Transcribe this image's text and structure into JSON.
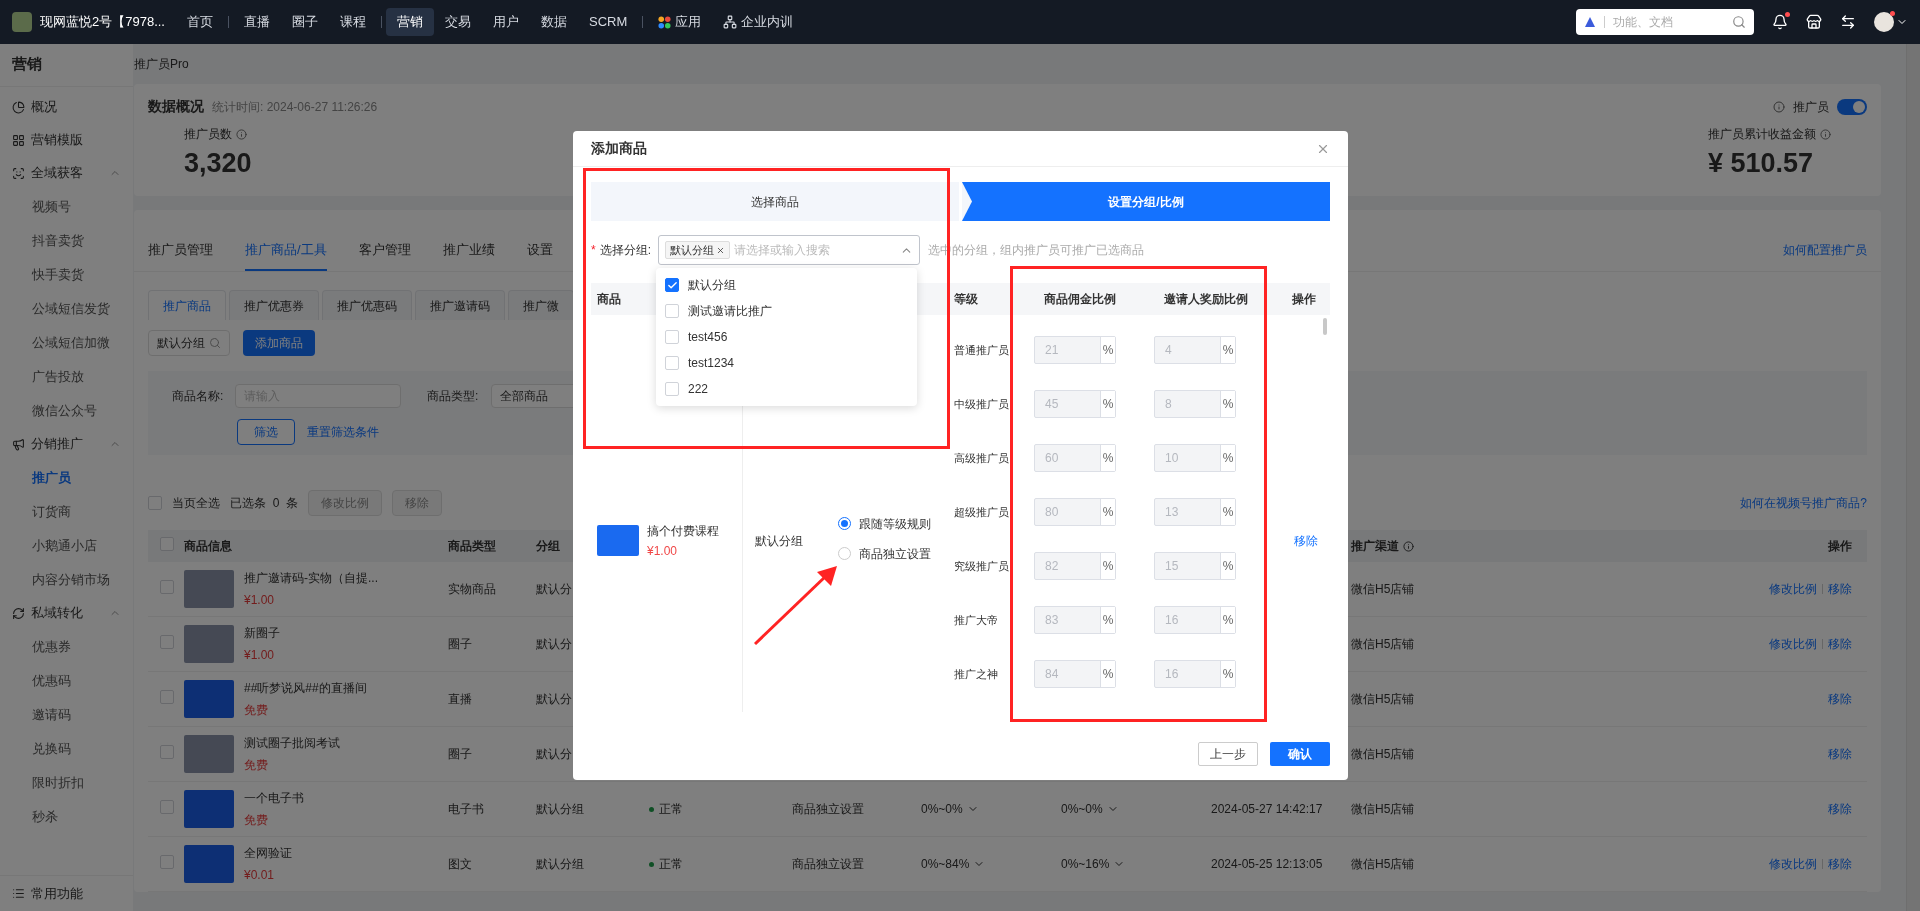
{
  "topbar": {
    "shop_name": "现网蓝悦2号【7978...",
    "nav_groups": [
      {
        "items": [
          {
            "label": "首页",
            "selected": false,
            "kind": "text"
          }
        ]
      },
      {
        "items": [
          {
            "label": "直播",
            "selected": false,
            "kind": "text"
          },
          {
            "label": "圈子",
            "selected": false,
            "kind": "text"
          },
          {
            "label": "课程",
            "selected": false,
            "kind": "text"
          }
        ]
      },
      {
        "items": [
          {
            "label": "营销",
            "selected": true,
            "kind": "text"
          },
          {
            "label": "交易",
            "selected": false,
            "kind": "text"
          },
          {
            "label": "用户",
            "selected": false,
            "kind": "text"
          },
          {
            "label": "数据",
            "selected": false,
            "kind": "text"
          },
          {
            "label": "SCRM",
            "selected": false,
            "kind": "text"
          }
        ]
      },
      {
        "items": [
          {
            "label": "应用",
            "selected": false,
            "kind": "apps"
          },
          {
            "label": "企业内训",
            "selected": false,
            "kind": "training"
          }
        ]
      }
    ],
    "search": {
      "placeholder": "功能、文档"
    }
  },
  "sidebar": {
    "title": "营销",
    "items": [
      {
        "label": "概况",
        "selected": false
      },
      {
        "label": "营销模版",
        "selected": false
      },
      {
        "label": "全域获客",
        "selected": false,
        "expanded": true,
        "children": [
          {
            "label": "视频号",
            "selected": false
          },
          {
            "label": "抖音卖货",
            "selected": false
          },
          {
            "label": "快手卖货",
            "selected": false
          },
          {
            "label": "公域短信发货",
            "selected": false
          },
          {
            "label": "公域短信加微",
            "selected": false
          },
          {
            "label": "广告投放",
            "selected": false
          },
          {
            "label": "微信公众号",
            "selected": false
          }
        ]
      },
      {
        "label": "分销推广",
        "selected": false,
        "expanded": true,
        "children": [
          {
            "label": "推广员",
            "selected": true
          },
          {
            "label": "订货商",
            "selected": false
          },
          {
            "label": "小鹅通小店",
            "selected": false
          },
          {
            "label": "内容分销市场",
            "selected": false
          }
        ]
      },
      {
        "label": "私域转化",
        "selected": false,
        "expanded": true,
        "children": [
          {
            "label": "优惠券",
            "selected": false
          },
          {
            "label": "优惠码",
            "selected": false
          },
          {
            "label": "邀请码",
            "selected": false
          },
          {
            "label": "兑换码",
            "selected": false
          },
          {
            "label": "限时折扣",
            "selected": false
          },
          {
            "label": "秒杀",
            "selected": false
          }
        ]
      }
    ],
    "footer": "常用功能"
  },
  "breadcrumb": "推广员Pro",
  "overview": {
    "title": "数据概况",
    "stat_time": "统计时间: 2024-06-27 11:26:26",
    "toggle": {
      "label": "推广员",
      "on": true
    },
    "stats": [
      {
        "label": "推广员数",
        "value": "3,320"
      },
      {
        "label": "推广员累计收益金额",
        "value": "¥ 510.57"
      }
    ]
  },
  "tabs": [
    {
      "label": "推广员管理",
      "selected": false
    },
    {
      "label": "推广商品/工具",
      "selected": true
    },
    {
      "label": "客户管理",
      "selected": false
    },
    {
      "label": "推广业绩",
      "selected": false
    },
    {
      "label": "设置",
      "selected": false
    }
  ],
  "help_link": "如何配置推广员",
  "subtabs": [
    {
      "label": "推广商品",
      "selected": true
    },
    {
      "label": "推广优惠券",
      "selected": false
    },
    {
      "label": "推广优惠码",
      "selected": false
    },
    {
      "label": "推广邀请码",
      "selected": false
    },
    {
      "label": "推广微",
      "selected": false
    }
  ],
  "group_search": {
    "value": "默认分组"
  },
  "add_button": "添加商品",
  "filter": {
    "name_label": "商品名称:",
    "name_placeholder": "请输入",
    "type_label": "商品类型:",
    "type_value": "全部商品",
    "filter_button": "筛选",
    "reset_link": "重置筛选条件"
  },
  "bulk": {
    "checked": false,
    "select_all": "当页全选",
    "selected_count": "已选条  0  条",
    "buttons": [
      {
        "label": "修改比例",
        "disabled": true
      },
      {
        "label": "移除",
        "disabled": true
      }
    ],
    "link": "如何在视频号推广商品?"
  },
  "table": {
    "columns": {
      "info": "商品信息",
      "type": "商品类型",
      "group": "分组",
      "channel": "推广渠道",
      "action": "操作"
    },
    "channel_info": true,
    "header_checked": false,
    "rows": [
      {
        "checked": false,
        "kind": "photo",
        "name": "推广邀请码-实物（自提...",
        "price": "¥1.00",
        "type": "实物商品",
        "group": "默认分",
        "channel": "微信H5店铺",
        "actions": [
          "修改比例",
          "移除"
        ]
      },
      {
        "checked": false,
        "kind": "photo",
        "name": "新圈子",
        "price": "¥1.00",
        "type": "圈子",
        "group": "默认分",
        "channel": "微信H5店铺",
        "actions": [
          "修改比例",
          "移除"
        ]
      },
      {
        "checked": false,
        "kind": "cover",
        "name": "##听梦说风##的直播间",
        "price": "免费",
        "type": "直播",
        "group": "默认分",
        "channel": "微信H5店铺",
        "actions": [
          "移除"
        ]
      },
      {
        "checked": false,
        "kind": "photo",
        "name": "测试圈子批阅考试",
        "price": "免费",
        "type": "圈子",
        "group": "默认分",
        "channel": "微信H5店铺",
        "actions": [
          "移除"
        ]
      },
      {
        "checked": false,
        "kind": "cover",
        "name": "一个电子书",
        "price": "免费",
        "type": "电子书",
        "group": "默认分组",
        "status": "正常",
        "setting": "商品独立设置",
        "commission_range": "0%~0%",
        "invite_range": "0%~0%",
        "time": "2024-05-27 14:42:17",
        "channel": "微信H5店铺",
        "actions": [
          "移除"
        ]
      },
      {
        "checked": false,
        "kind": "cover",
        "name": "全网验证",
        "price": "¥0.01",
        "type": "图文",
        "group": "默认分组",
        "status": "正常",
        "setting": "商品独立设置",
        "commission_range": "0%~84%",
        "invite_range": "0%~16%",
        "time": "2024-05-25 12:13:05",
        "channel": "微信H5店铺",
        "actions": [
          "修改比例",
          "移除"
        ]
      }
    ]
  },
  "modal": {
    "title": "添加商品",
    "steps": [
      {
        "label": "选择商品",
        "selected": false
      },
      {
        "label": "设置分组/比例",
        "selected": true
      }
    ],
    "group_field": {
      "required_mark": "*",
      "label": "选择分组:",
      "tags": [
        "默认分组"
      ],
      "placeholder": "请选择或输入搜索",
      "open": true
    },
    "hint": "选中的分组，组内推广员可推广已选商品",
    "dropdown": [
      {
        "label": "默认分组",
        "checked": true
      },
      {
        "label": "测试邀请比推广",
        "checked": false
      },
      {
        "label": "test456",
        "checked": false
      },
      {
        "label": "test1234",
        "checked": false
      },
      {
        "label": "222",
        "checked": false
      }
    ],
    "columns": {
      "product": "商品",
      "level": "等级",
      "commission": "商品佣金比例",
      "invite": "邀请人奖励比例",
      "action": "操作"
    },
    "item": {
      "name": "搞个付费课程",
      "price": "¥1.00",
      "group": "默认分组",
      "modes": [
        {
          "label": "跟随等级规则",
          "selected": true
        },
        {
          "label": "商品独立设置",
          "selected": false
        }
      ],
      "inputs_disabled": true,
      "unit": "%",
      "levels": [
        {
          "name": "普通推广员",
          "commission": "21",
          "invite": "4"
        },
        {
          "name": "中级推广员",
          "commission": "45",
          "invite": "8"
        },
        {
          "name": "高级推广员",
          "commission": "60",
          "invite": "10"
        },
        {
          "name": "超级推广员",
          "commission": "80",
          "invite": "13"
        },
        {
          "name": "究级推广员",
          "commission": "82",
          "invite": "15"
        },
        {
          "name": "推广大帝",
          "commission": "83",
          "invite": "16"
        },
        {
          "name": "推广之神",
          "commission": "84",
          "invite": "16"
        }
      ],
      "action": "移除"
    },
    "buttons": [
      {
        "label": "上一步",
        "kind": "secondary"
      },
      {
        "label": "确认",
        "kind": "primary"
      }
    ]
  }
}
